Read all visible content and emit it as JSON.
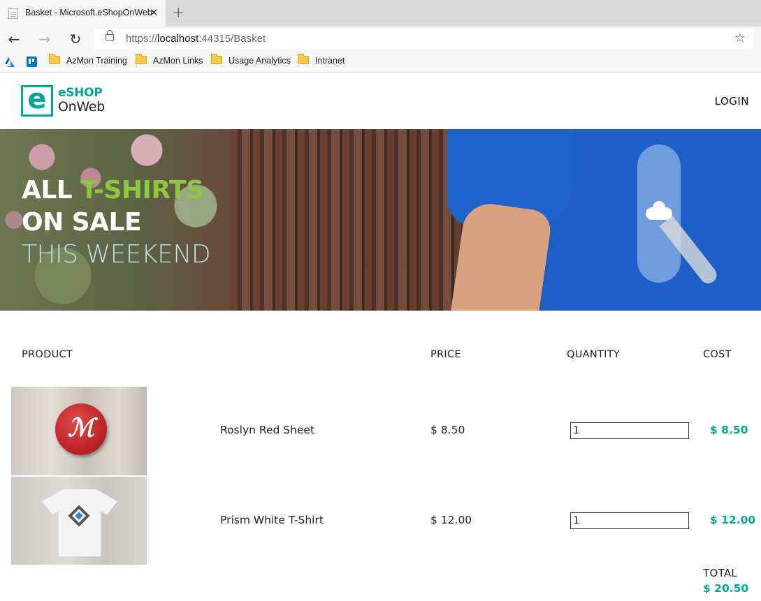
{
  "browser": {
    "tab_title": "Basket - Microsoft.eShopOnWeb",
    "tab_close": "✕",
    "new_tab": "+",
    "back_glyph": "←",
    "forward_glyph": "→",
    "reload_glyph": "↻",
    "url_prefix": "https://",
    "url_host": "localhost",
    "url_rest": ":44315/Basket",
    "star_glyph": "☆",
    "bookmarks": [
      {
        "label": "AzMon Training"
      },
      {
        "label": "AzMon Links"
      },
      {
        "label": "Usage Analytics"
      },
      {
        "label": "Intranet"
      }
    ]
  },
  "header": {
    "logo_mark": "e",
    "logo_line1": "eSHOP",
    "logo_line2": "OnWeb",
    "login": "LOGIN"
  },
  "hero": {
    "line1_a": "ALL ",
    "line1_b": "T-SHIRTS",
    "line2": "ON SALE",
    "line3": "THIS WEEKEND"
  },
  "basket": {
    "columns": {
      "product": "PRODUCT",
      "price": "PRICE",
      "quantity": "QUANTITY",
      "cost": "COST"
    },
    "items": [
      {
        "name": "Roslyn Red Sheet",
        "price": "$ 8.50",
        "quantity": "1",
        "cost": "$ 8.50",
        "badge_glyph": "ℳ"
      },
      {
        "name": "Prism White T-Shirt",
        "price": "$ 12.00",
        "quantity": "1",
        "cost": "$ 12.00"
      }
    ],
    "total_label": "TOTAL",
    "total_value": "$ 20.50"
  },
  "colors": {
    "accent_teal": "#00a69c",
    "hero_green": "#8dc63f",
    "hero_light_blue": "#b9e2ea"
  }
}
